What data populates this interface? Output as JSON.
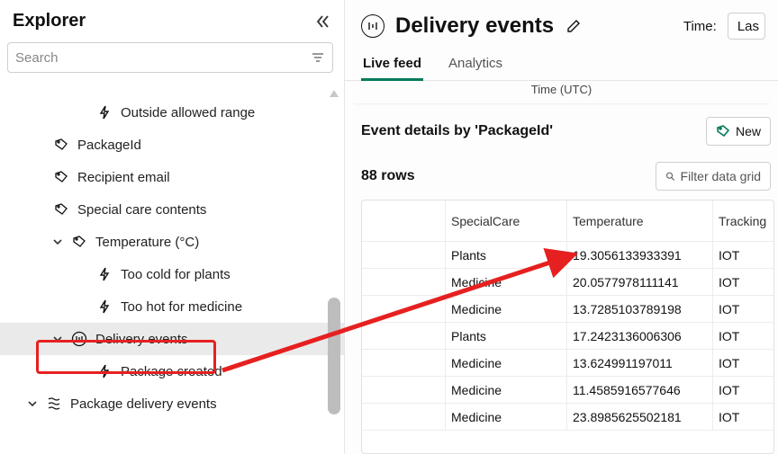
{
  "sidebar": {
    "title": "Explorer",
    "search_placeholder": "Search",
    "items": [
      {
        "type": "child",
        "label": "Outside allowed range",
        "icon": "bolt"
      },
      {
        "type": "parent",
        "label": "PackageId",
        "icon": "tag",
        "collapsed": true
      },
      {
        "type": "parent",
        "label": "Recipient email",
        "icon": "tag",
        "collapsed": true
      },
      {
        "type": "parent",
        "label": "Special care contents",
        "icon": "tag",
        "collapsed": true
      },
      {
        "type": "parent",
        "label": "Temperature (°C)",
        "icon": "tag",
        "expanded": true
      },
      {
        "type": "child",
        "label": "Too cold for plants",
        "icon": "bolt"
      },
      {
        "type": "child",
        "label": "Too hot for medicine",
        "icon": "bolt"
      },
      {
        "type": "parent2",
        "label": "Delivery events",
        "icon": "events-circle",
        "selected": true,
        "expanded": true
      },
      {
        "type": "child",
        "label": "Package created",
        "icon": "bolt"
      },
      {
        "type": "parent1",
        "label": "Package delivery events",
        "icon": "flow",
        "expanded": true
      }
    ]
  },
  "header": {
    "title": "Delivery events",
    "time_label": "Time:",
    "time_value": "Las"
  },
  "tabs": {
    "live": "Live feed",
    "analytics": "Analytics"
  },
  "axis_label": "Time (UTC)",
  "details": {
    "title": "Event details by 'PackageId'",
    "new_button": "New",
    "row_count": "88 rows",
    "filter_placeholder": "Filter data grid"
  },
  "grid": {
    "columns": {
      "c1": "SpecialCare",
      "c2": "Temperature",
      "c3": "Tracking"
    },
    "rows": [
      {
        "sc": "Plants",
        "temp": "19.3056133933391",
        "tr": "IOT"
      },
      {
        "sc": "Medicine",
        "temp": "20.0577978111141",
        "tr": "IOT"
      },
      {
        "sc": "Medicine",
        "temp": "13.7285103789198",
        "tr": "IOT"
      },
      {
        "sc": "Plants",
        "temp": "17.2423136006306",
        "tr": "IOT"
      },
      {
        "sc": "Medicine",
        "temp": "13.624991197011",
        "tr": "IOT"
      },
      {
        "sc": "Medicine",
        "temp": "11.4585916577646",
        "tr": "IOT"
      },
      {
        "sc": "Medicine",
        "temp": "23.8985625502181",
        "tr": "IOT"
      }
    ]
  }
}
